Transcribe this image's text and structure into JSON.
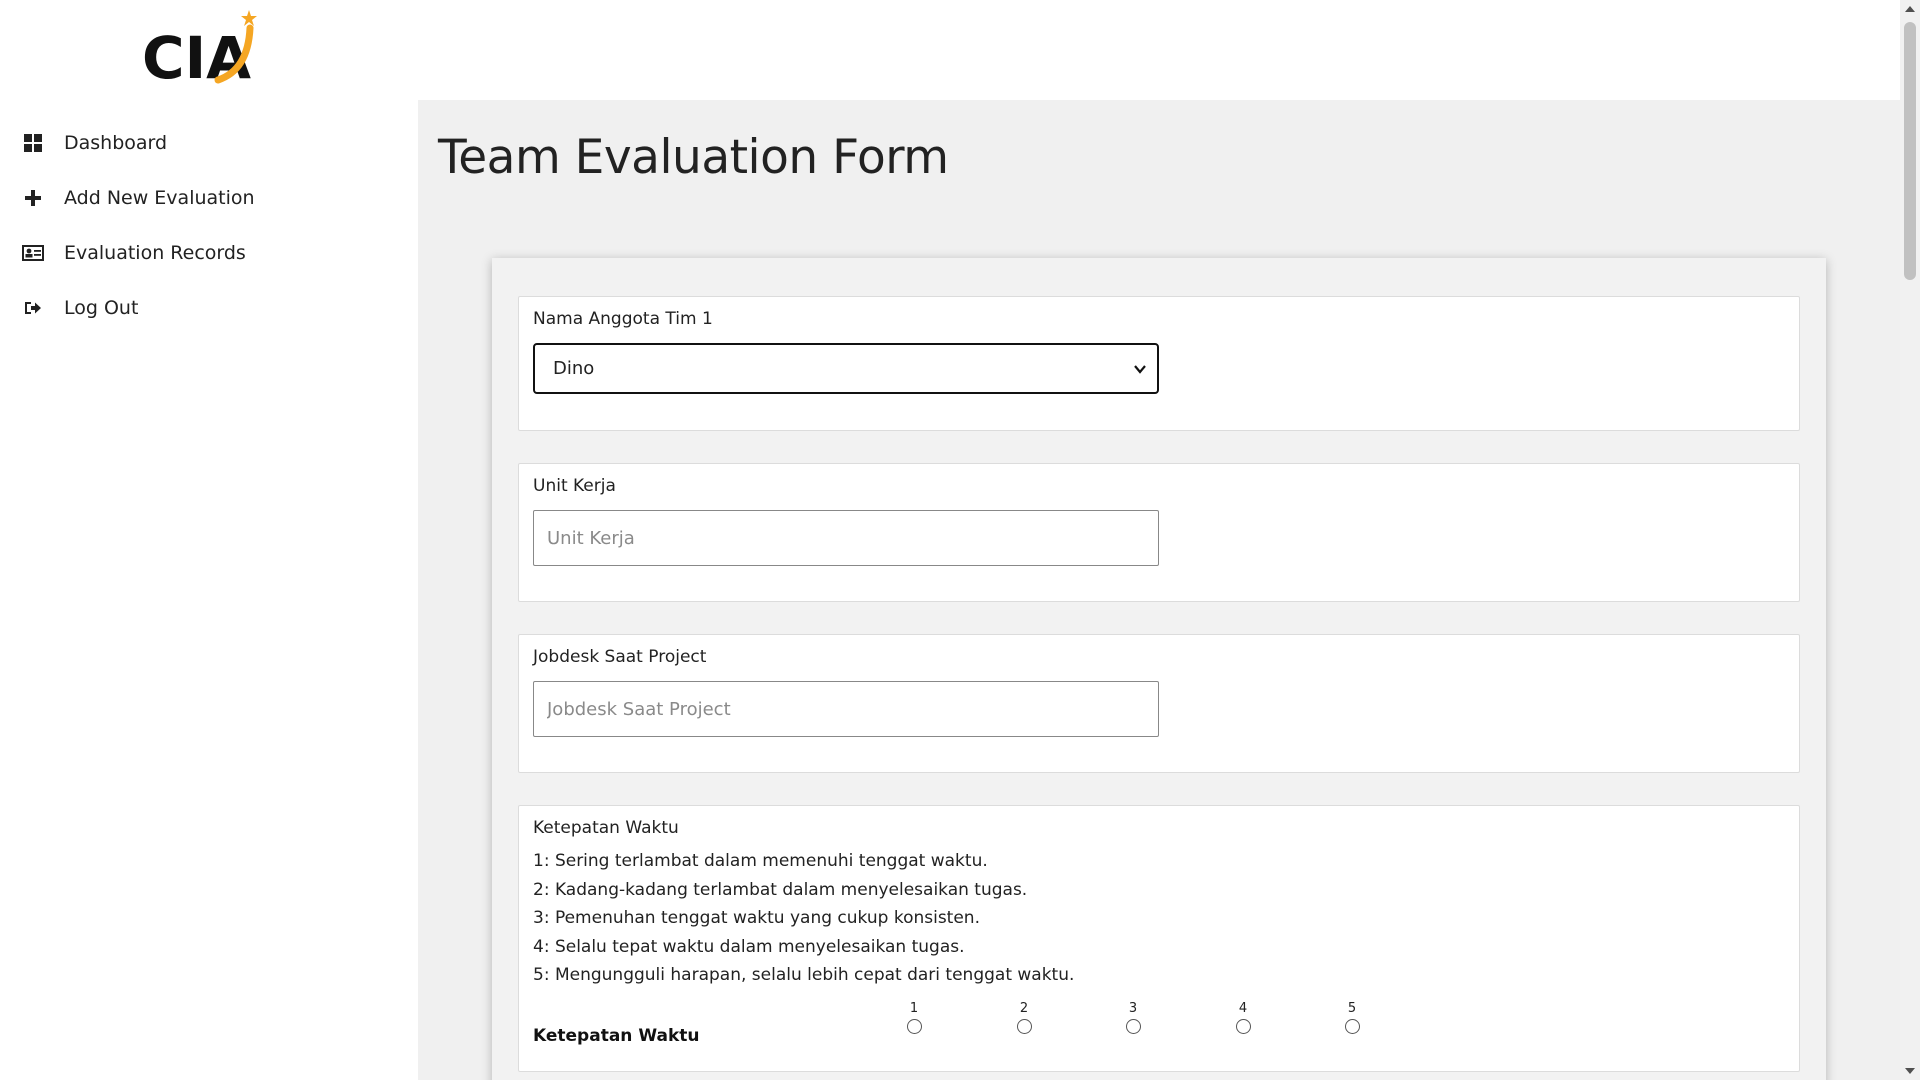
{
  "logo": {
    "text": "CIA",
    "accent_color": "#f5a623"
  },
  "sidebar": {
    "items": [
      {
        "label": "Dashboard",
        "icon": "grid-icon"
      },
      {
        "label": "Add New Evaluation",
        "icon": "plus-icon"
      },
      {
        "label": "Evaluation Records",
        "icon": "id-card-icon"
      },
      {
        "label": "Log Out",
        "icon": "logout-icon"
      }
    ]
  },
  "page": {
    "title": "Team Evaluation Form"
  },
  "form": {
    "member": {
      "label": "Nama Anggota Tim 1",
      "value": "Dino"
    },
    "unit": {
      "label": "Unit Kerja",
      "placeholder": "Unit Kerja"
    },
    "jobdesk": {
      "label": "Jobdesk Saat Project",
      "placeholder": "Jobdesk Saat Project"
    },
    "criteria": {
      "title": "Ketepatan Waktu",
      "lines": [
        "1: Sering terlambat dalam memenuhi tenggat waktu.",
        "2: Kadang-kadang terlambat dalam menyelesaikan tugas.",
        "3: Pemenuhan tenggat waktu yang cukup konsisten.",
        "4: Selalu tepat waktu dalam menyelesaikan tugas.",
        "5: Mengungguli harapan, selalu lebih cepat dari tenggat waktu."
      ],
      "rating_label": "Ketepatan Waktu",
      "scale": [
        "1",
        "2",
        "3",
        "4",
        "5"
      ]
    }
  }
}
